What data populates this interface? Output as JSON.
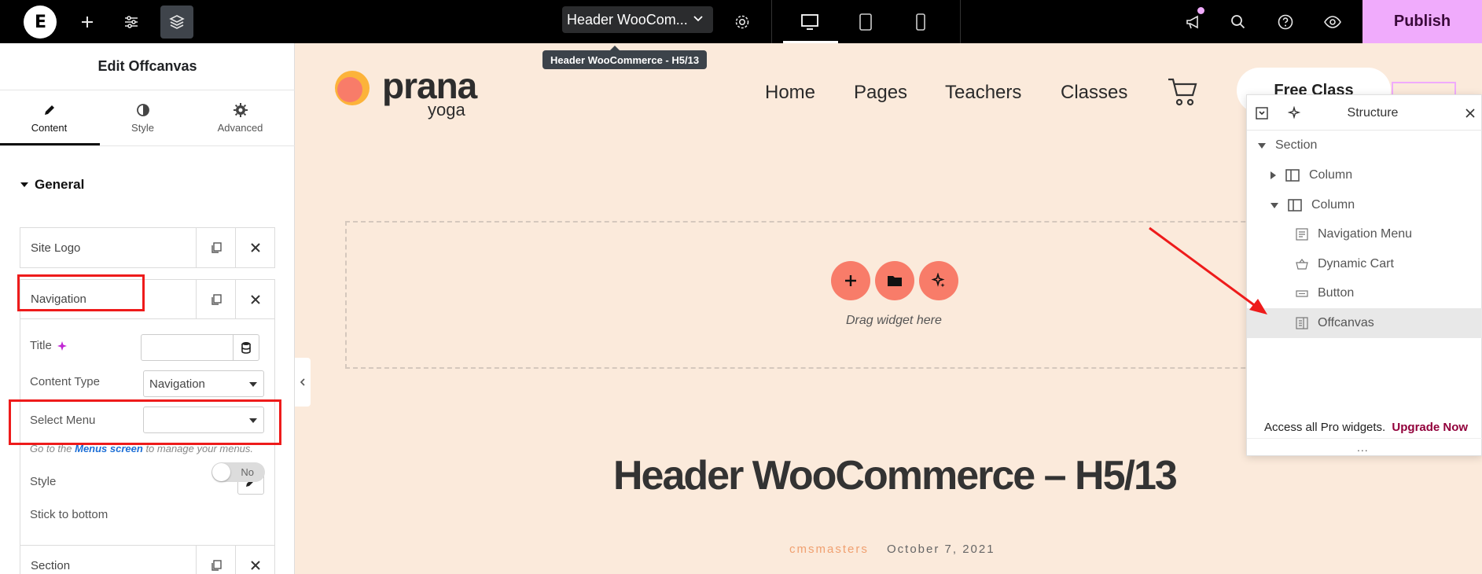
{
  "topbar": {
    "logo_letter": "E",
    "document_title": "Header WooCom...",
    "tooltip": "Header WooCommerce - H5/13",
    "publish_label": "Publish"
  },
  "panel": {
    "title": "Edit Offcanvas",
    "tabs": [
      {
        "label": "Content"
      },
      {
        "label": "Style"
      },
      {
        "label": "Advanced"
      }
    ],
    "section": "General",
    "repeater_items": [
      {
        "label": "Site Logo"
      },
      {
        "label": "Navigation"
      },
      {
        "label": "Section"
      }
    ],
    "controls": {
      "title_label": "Title",
      "title_value": "",
      "content_type_label": "Content Type",
      "content_type_value": "Navigation",
      "select_menu_label": "Select Menu",
      "select_menu_value": "",
      "help_prefix": "Go to the",
      "help_link": "Menus screen",
      "help_suffix": "to manage your menus.",
      "style_label": "Style",
      "stick_label": "Stick to bottom",
      "stick_value": "No"
    }
  },
  "canvas": {
    "brand_name": "prana",
    "brand_sub": "yoga",
    "nav": [
      "Home",
      "Pages",
      "Teachers",
      "Classes"
    ],
    "cta": "Free Class",
    "drag_text": "Drag widget here",
    "heading": "Header WooCommerce – H5/13",
    "author": "cmsmasters",
    "date": "October 7, 2021"
  },
  "structure": {
    "title": "Structure",
    "items": [
      {
        "label": "Section"
      },
      {
        "label": "Column"
      },
      {
        "label": "Column"
      },
      {
        "label": "Navigation Menu"
      },
      {
        "label": "Dynamic Cart"
      },
      {
        "label": "Button"
      },
      {
        "label": "Offcanvas"
      }
    ],
    "footer_text": "Access all Pro widgets.",
    "footer_link": "Upgrade Now",
    "grip": "..."
  },
  "colors": {
    "canvas_bg": "#fbeadb",
    "publish_bg": "#f0abfc",
    "accent_coral": "#f87c69",
    "annotation_red": "#ee1b1b",
    "upgrade_link": "#92003b",
    "author_color": "#f0a070"
  }
}
